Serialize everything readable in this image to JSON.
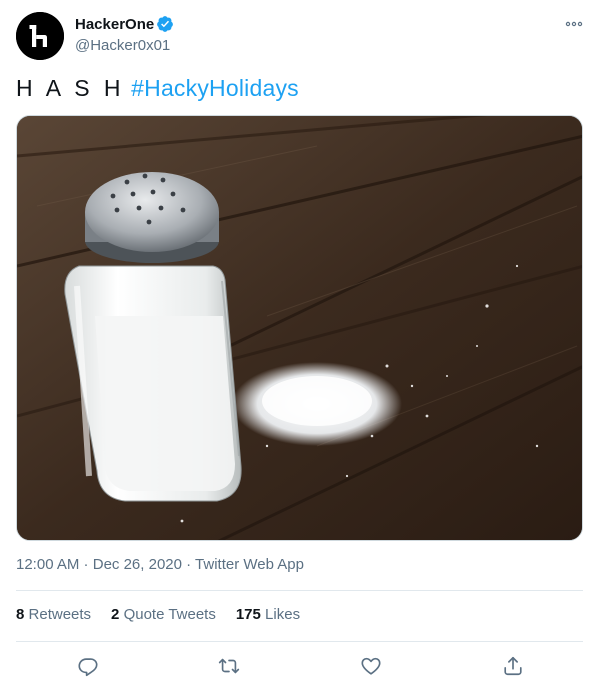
{
  "author": {
    "display_name": "HackerOne",
    "handle": "@Hacker0x01",
    "verified": true,
    "avatar_icon": "hackerone-logo-icon"
  },
  "tweet": {
    "text_plain": "H A S H",
    "hashtag": "#HackyHolidays",
    "media_description": "salt-shaker-photo"
  },
  "meta": {
    "time": "12:00 AM",
    "sep1": " · ",
    "date": "Dec 26, 2020",
    "sep2": " · ",
    "source": "Twitter Web App"
  },
  "stats": {
    "retweets_count": "8",
    "retweets_label": "Retweets",
    "quotes_count": "2",
    "quotes_label": "Quote Tweets",
    "likes_count": "175",
    "likes_label": "Likes"
  },
  "actions": [
    "reply-icon",
    "retweet-icon",
    "like-icon",
    "share-icon"
  ],
  "colors": {
    "accent": "#1da1f2",
    "secondary_text": "#5b7083",
    "primary_text": "#0f1419",
    "divider": "#e1e8ed"
  }
}
